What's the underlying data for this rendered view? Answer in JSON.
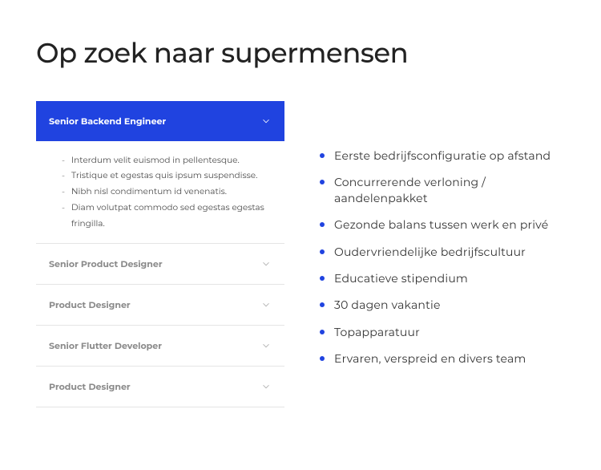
{
  "heading": "Op zoek naar supermensen",
  "accordion": [
    {
      "title": "Senior Backend Engineer",
      "active": true,
      "items": [
        "Interdum velit euismod in pellentesque.",
        "Tristique et egestas quis ipsum suspendisse.",
        "Nibh nisl condimentum id venenatis.",
        "Diam volutpat commodo sed egestas egestas fringilla."
      ]
    },
    {
      "title": "Senior Product Designer",
      "active": false
    },
    {
      "title": "Product Designer",
      "active": false
    },
    {
      "title": "Senior Flutter Developer",
      "active": false
    },
    {
      "title": "Product Designer",
      "active": false
    }
  ],
  "benefits": [
    "Eerste bedrijfsconfiguratie op afstand",
    "Concurrerende verloning / aandelenpakket",
    "Gezonde balans tussen werk en privé",
    "Oudervriendelijke bedrijfscultuur",
    "Educatieve stipendium",
    "30 dagen vakantie",
    "Topapparatuur",
    "Ervaren, verspreid en divers team"
  ],
  "colors": {
    "accent": "#2043e0"
  }
}
